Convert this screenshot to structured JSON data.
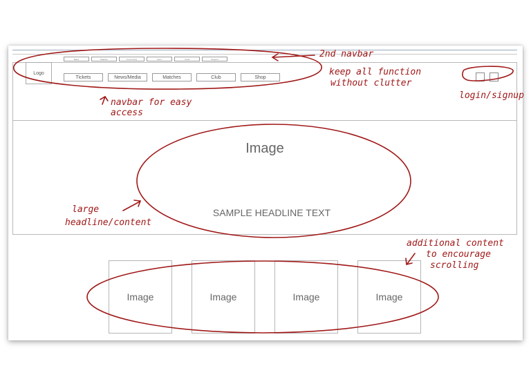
{
  "secondary_nav": [
    "Band",
    "Stadium",
    "Community",
    "Fans",
    "Youth",
    "Support"
  ],
  "logo_label": "Logo",
  "main_nav": [
    "Tickets",
    "News/Media",
    "Matches",
    "Club",
    "Shop"
  ],
  "hero": {
    "image_label": "Image",
    "headline": "SAMPLE HEADLINE TEXT"
  },
  "cards": [
    "Image",
    "Image",
    "Image",
    "Image"
  ],
  "annotations": {
    "second_navbar": "2nd navbar",
    "keep_all_1": "keep all function",
    "keep_all_2": "without clutter",
    "navbar_easy_1": "navbar for easy",
    "navbar_easy_2": "access",
    "login": "login/signup",
    "large_1": "large",
    "large_2": "headline/content",
    "additional_1": "additional content",
    "additional_2": "to encourage",
    "additional_3": "scrolling"
  },
  "colors": {
    "annotation_red": "#a01818",
    "rule_blue": "#9aa8bb"
  }
}
